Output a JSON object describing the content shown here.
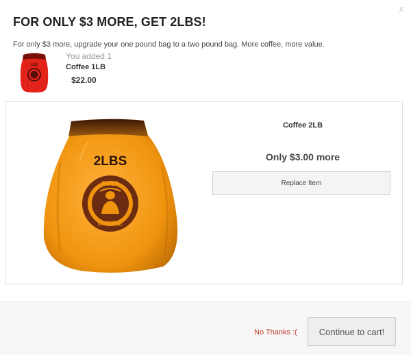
{
  "modal": {
    "close_label": "x",
    "title": "FOR ONLY $3 MORE, GET 2LBS!",
    "subtitle": "For only $3 more, upgrade your one pound bag to a two pound bag. More coffee, more value."
  },
  "added_item": {
    "note": "You added 1",
    "name": "Coffee 1LB",
    "price": "$22.00",
    "bag_label": "1LB",
    "bag_color": "#e2231a"
  },
  "offer": {
    "name": "Coffee 2LB",
    "price_text": "Only $3.00 more",
    "replace_label": "Replace Item",
    "bag_label": "2LBS",
    "seal_top": "BOLD",
    "seal_bottom": "COFFEE",
    "bag_color": "#f0940f",
    "seal_color": "#6b2c12"
  },
  "footer": {
    "no_thanks_label": "No Thanks :(",
    "continue_label": "Continue to cart!"
  },
  "colors": {
    "no_thanks": "#c0392b"
  }
}
